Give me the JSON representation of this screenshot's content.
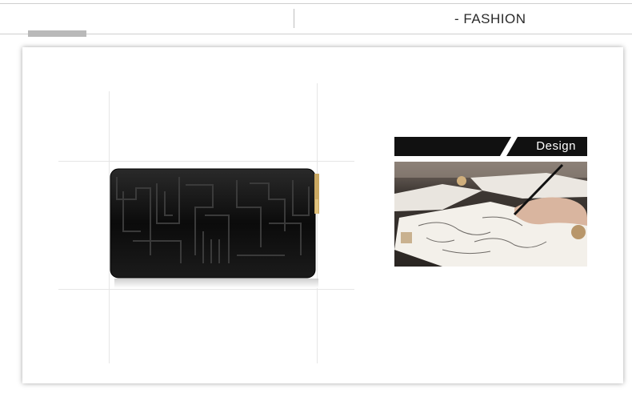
{
  "header": {
    "section_label": "- FASHION"
  },
  "design_panel": {
    "banner_label": "Design"
  },
  "colors": {
    "banner": "#111111",
    "wallet": "#0d0d0d",
    "zipper": "#c9a865"
  },
  "icons": [
    "wallet-product-image",
    "design-sketch-photo"
  ]
}
